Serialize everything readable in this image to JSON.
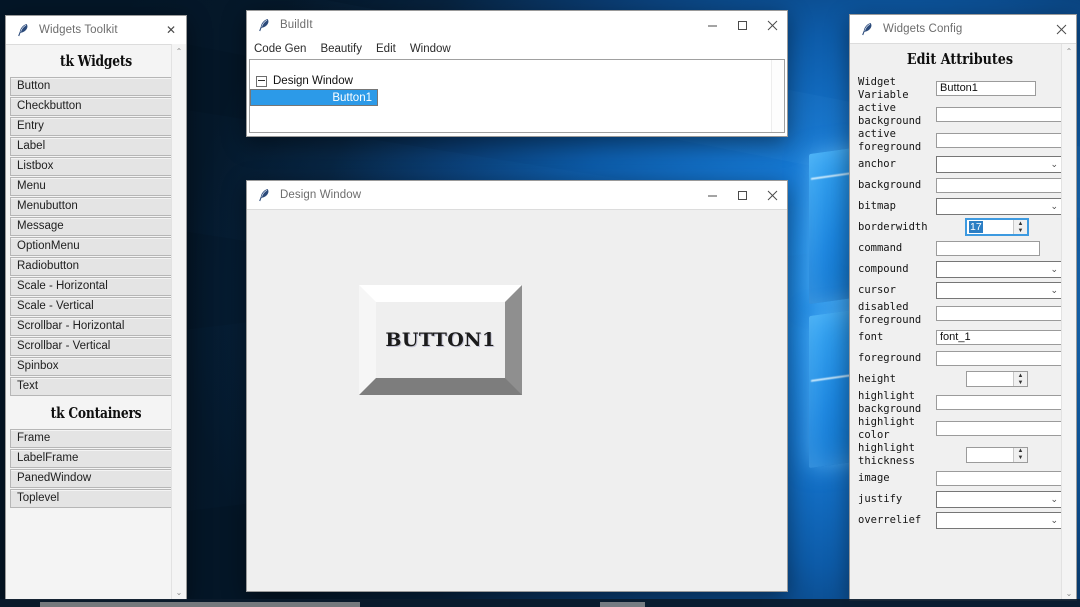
{
  "toolkit_window": {
    "title": "Widgets Toolkit",
    "icon": "feather-icon",
    "close_label": "✕",
    "sections": [
      {
        "heading": "tk Widgets",
        "items": [
          "Button",
          "Checkbutton",
          "Entry",
          "Label",
          "Listbox",
          "Menu",
          "Menubutton",
          "Message",
          "OptionMenu",
          "Radiobutton",
          "Scale - Horizontal",
          "Scale - Vertical",
          "Scrollbar - Horizontal",
          "Scrollbar - Vertical",
          "Spinbox",
          "Text"
        ]
      },
      {
        "heading": "tk Containers",
        "items": [
          "Frame",
          "LabelFrame",
          "PanedWindow",
          "Toplevel"
        ]
      }
    ],
    "scroll_up": "⌃",
    "scroll_down": "⌄"
  },
  "buildit_window": {
    "title": "BuildIt",
    "icon": "feather-icon",
    "minimize_label": "—",
    "maximize_label": "□",
    "close_label": "✕",
    "menu": [
      "Code Gen",
      "Beautify",
      "Edit",
      "Window"
    ],
    "tree": [
      {
        "label": "Design Window",
        "level": 0,
        "selected": false,
        "expander": true
      },
      {
        "label": "Button1",
        "level": 1,
        "selected": true,
        "expander": false
      }
    ]
  },
  "design_window": {
    "title": "Design Window",
    "icon": "feather-icon",
    "minimize_label": "—",
    "maximize_label": "□",
    "close_label": "✕",
    "button": {
      "text": "BUTTON1"
    }
  },
  "config_window": {
    "title": "Widgets Config",
    "icon": "feather-icon",
    "close_label": "✕",
    "heading": "Edit Attributes",
    "scroll_up": "⌃",
    "scroll_down": "⌄",
    "expand_label": ">>",
    "chevron": "⌄",
    "spin_up": "▲",
    "spin_down": "▼",
    "attributes": [
      {
        "label": "Widget\nVariable",
        "control": "entry",
        "value": "Button1",
        "width": "wide"
      },
      {
        "label": "active\nbackground",
        "control": "entry-btn",
        "value": ""
      },
      {
        "label": "active\nforeground",
        "control": "entry-btn",
        "value": ""
      },
      {
        "label": "anchor",
        "control": "select",
        "value": ""
      },
      {
        "label": "background",
        "control": "entry-btn",
        "value": ""
      },
      {
        "label": "bitmap",
        "control": "select",
        "value": ""
      },
      {
        "label": "borderwidth",
        "control": "spin-focus",
        "value": "17"
      },
      {
        "label": "command",
        "control": "entry",
        "value": "",
        "width": "mid"
      },
      {
        "label": "compound",
        "control": "select",
        "value": ""
      },
      {
        "label": "cursor",
        "control": "select",
        "value": ""
      },
      {
        "label": "disabled\nforeground",
        "control": "entry-btn",
        "value": ""
      },
      {
        "label": "font",
        "control": "entry-btn",
        "value": "font_1"
      },
      {
        "label": "foreground",
        "control": "entry-btn",
        "value": ""
      },
      {
        "label": "height",
        "control": "spin",
        "value": ""
      },
      {
        "label": "highlight\nbackground",
        "control": "entry-btn",
        "value": ""
      },
      {
        "label": "highlight\ncolor",
        "control": "entry-btn",
        "value": ""
      },
      {
        "label": "highlight\nthickness",
        "control": "spin",
        "value": ""
      },
      {
        "label": "image",
        "control": "entry-btn",
        "value": ""
      },
      {
        "label": "justify",
        "control": "select",
        "value": ""
      },
      {
        "label": "overrelief",
        "control": "select",
        "value": ""
      }
    ]
  },
  "colors": {
    "accent": "#2c9ae8",
    "selection": "#2b7ec4",
    "window_bg": "#f0f0f0",
    "desktop": "#0a1a2e"
  }
}
